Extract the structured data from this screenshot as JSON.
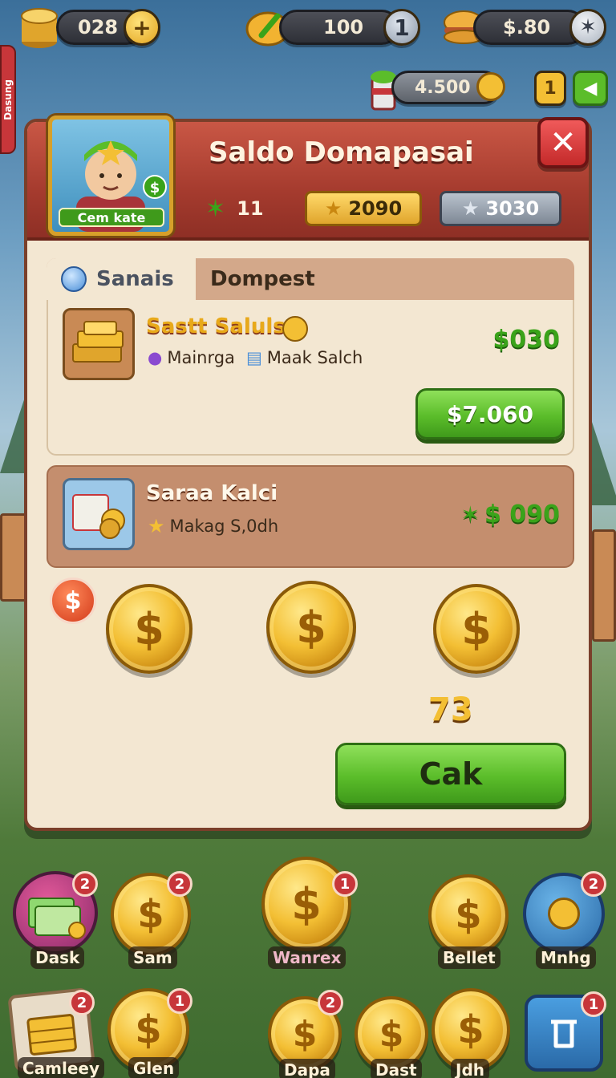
{
  "hud": {
    "coins": "028",
    "energy": "100",
    "energy_badge": "1",
    "cash": "$.80",
    "side_value": "4.500",
    "side_badge": "1",
    "left_tab": "Dasung"
  },
  "panel": {
    "title": "Saldo Domapasai",
    "avatar_label": "Cem kate",
    "stat_level": "11",
    "stat_gold": "2090",
    "stat_silver": "3030",
    "tabs": [
      "Sanais",
      "Dompest"
    ],
    "item1": {
      "title": "Sastt Saluls",
      "tag1": "Mainrga",
      "tag2": "Maak Salch",
      "price": "$030",
      "button": "$7.060"
    },
    "item2": {
      "title": "Saraa Kalci",
      "tag": "Makag S,0dh",
      "price": "$ 090"
    },
    "coin_total": "73",
    "confirm_button": "Cak"
  },
  "dock_row1": [
    {
      "label": "Dask",
      "badge": "2"
    },
    {
      "label": "Sam",
      "badge": "2"
    },
    {
      "label": "Wanrex",
      "badge": "1"
    },
    {
      "label": "Bellet",
      "badge": ""
    },
    {
      "label": "Mnhg",
      "badge": "2"
    }
  ],
  "dock_row2": [
    {
      "label": "Camleey",
      "badge": "2"
    },
    {
      "label": "Glen",
      "badge": "1"
    },
    {
      "label": "Dapa",
      "badge": "2"
    },
    {
      "label": "Dast",
      "badge": ""
    },
    {
      "label": "Jdh",
      "badge": ""
    },
    {
      "label": "",
      "badge": "1"
    }
  ],
  "colors": {
    "accent_red": "#c7363a",
    "accent_green": "#5bbd2a",
    "gold": "#f3bf34",
    "panel_bg": "#f3e7d2"
  }
}
